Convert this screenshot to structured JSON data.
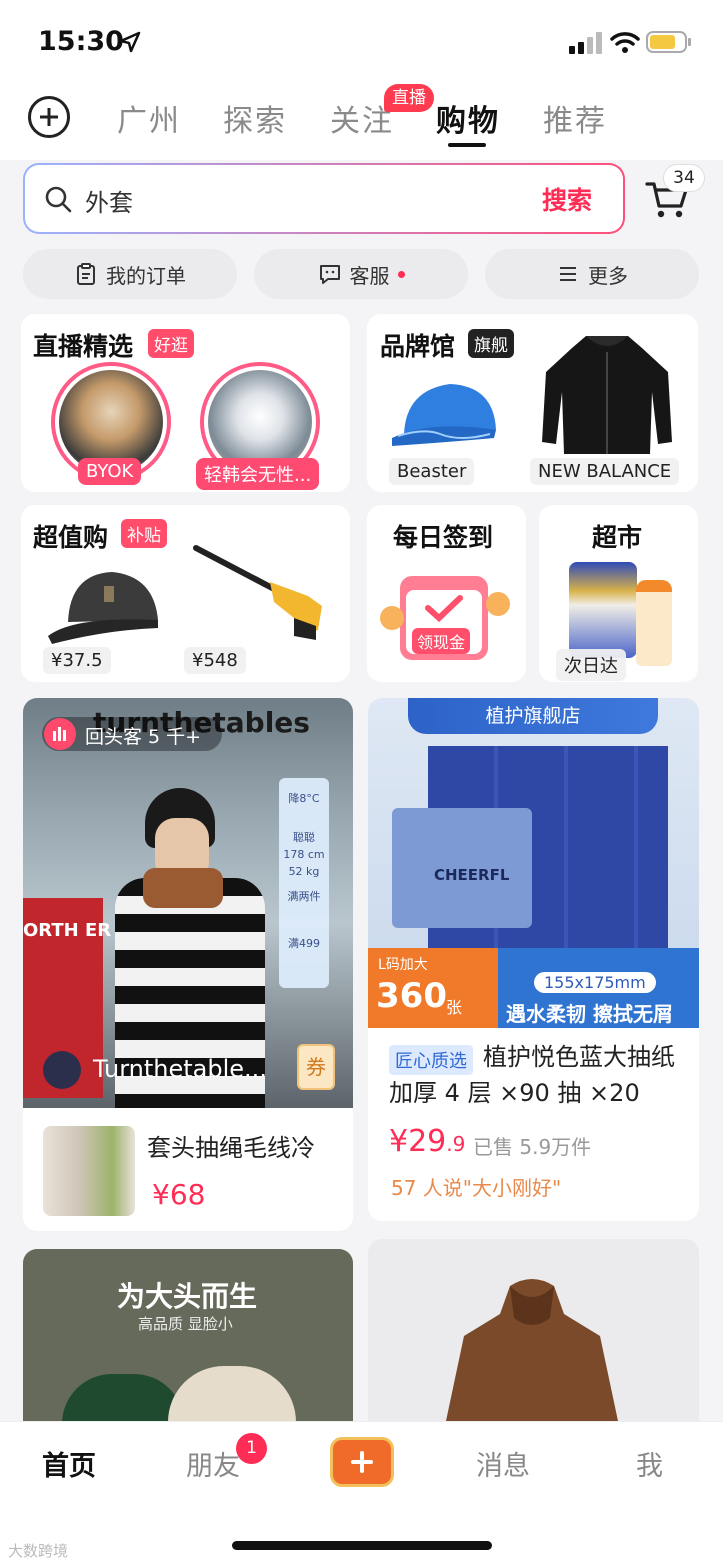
{
  "status_bar": {
    "time": "15:30"
  },
  "top_tabs": [
    {
      "label": "广州"
    },
    {
      "label": "探索"
    },
    {
      "label": "关注"
    },
    {
      "label": "购物"
    },
    {
      "label": "推荐"
    }
  ],
  "live_badge": "直播",
  "search": {
    "value": "外套",
    "button": "搜索",
    "cart_count": "34"
  },
  "quick_actions": {
    "orders": "我的订单",
    "service": "客服",
    "more": "更多"
  },
  "live_picks": {
    "title": "直播精选",
    "tag": "好逛",
    "streams": [
      {
        "label": "BYOK"
      },
      {
        "label": "轻韩会无性..."
      }
    ]
  },
  "brand_hall": {
    "title": "品牌馆",
    "tag": "旗舰",
    "brands": [
      {
        "label": "Beaster"
      },
      {
        "label": "NEW BALANCE"
      }
    ]
  },
  "value_buy": {
    "title": "超值购",
    "tag": "补贴",
    "items": [
      {
        "price": "¥37.5"
      },
      {
        "price": "¥548"
      }
    ]
  },
  "daily_checkin": {
    "title": "每日签到",
    "calendar_text": "领现金"
  },
  "supermarket": {
    "title": "超市",
    "label": "次日达"
  },
  "feed": {
    "live_card": {
      "brand_banner": "turnthetables",
      "viewer_badge": "回头客 5 千+",
      "shop_name": "Turnthetable...",
      "coupon": "券",
      "rack_text": "ORTH ER",
      "side_panel": [
        "降8°C",
        "聪聪",
        "178 cm",
        "52 kg",
        "满两件",
        "满499"
      ],
      "product_title": "套头抽绳毛线冷",
      "product_price": "¥68"
    },
    "tissue_card": {
      "store_banner": "植护旗舰店",
      "box_brand": "CHEERFL",
      "size_label": "L码加大",
      "count": "360",
      "count_unit": "张",
      "dimension": "155x175mm",
      "slogan": "遇水柔韧 擦拭无屑",
      "tag": "匠心质选",
      "title": "植护悦色蓝大抽纸加厚 4 层 ×90 抽 ×20",
      "price_main": "¥29",
      "price_decimal": ".9",
      "sold": "已售 5.9万件",
      "review": "57 人说\"大小刚好\""
    },
    "cap_ad": {
      "headline": "为大头而生",
      "subline": "高品质 显脸小"
    }
  },
  "bottom_nav": {
    "home": "首页",
    "friends": "朋友",
    "friends_badge": "1",
    "messages": "消息",
    "me": "我"
  },
  "watermark": "大数跨境"
}
